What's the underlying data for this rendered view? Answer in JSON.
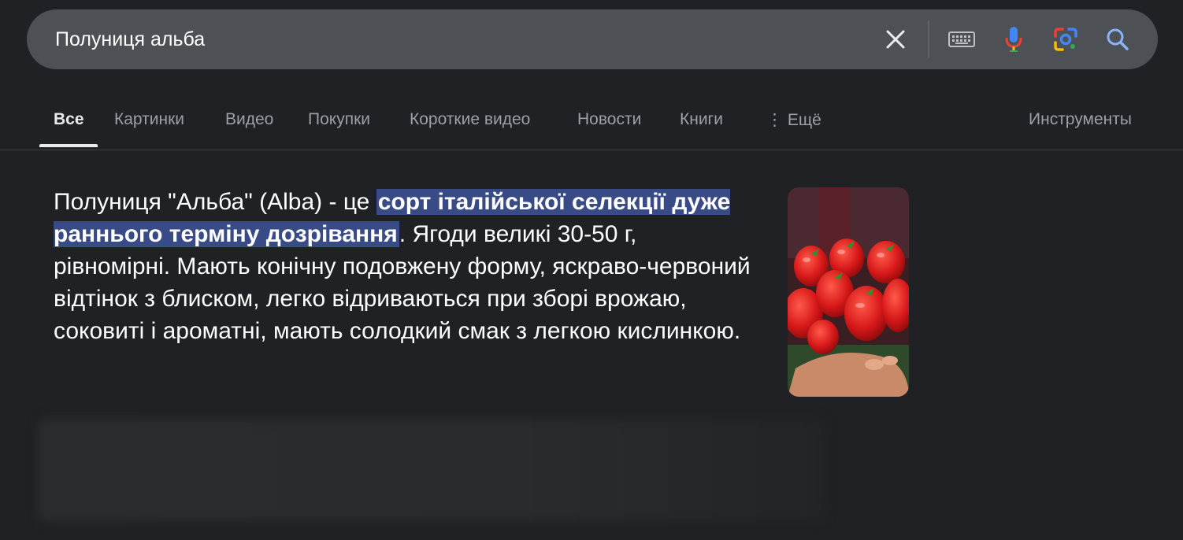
{
  "search": {
    "query": "Полуниця альба"
  },
  "icons": {
    "clear": "close-icon",
    "keyboard": "keyboard-icon",
    "voice": "microphone-icon",
    "lens": "camera-lens-icon",
    "search": "search-icon"
  },
  "tabs": [
    {
      "label": "Все",
      "active": true
    },
    {
      "label": "Картинки"
    },
    {
      "label": "Видео"
    },
    {
      "label": "Покупки"
    },
    {
      "label": "Короткие видео"
    },
    {
      "label": "Новости"
    },
    {
      "label": "Книги"
    },
    {
      "label": "⋮ Ещё"
    }
  ],
  "tools_label": "Инструменты",
  "snippet": {
    "before": "Полуниця \"Альба\" (Alba) - це ",
    "highlight": "сорт італійської селекції дуже раннього терміну дозрівання",
    "after": ". Ягоди великі 30-50 г, рівномірні. Мають конічну подовжену форму, яскраво-червоний відтінок з блиском, легко відриваються при зборі врожаю, соковиті і ароматні, мають солодкий смак з легкою кислинкою."
  },
  "colors": {
    "background": "#202124",
    "searchbar": "#4d5156",
    "highlight": "#394b86"
  }
}
